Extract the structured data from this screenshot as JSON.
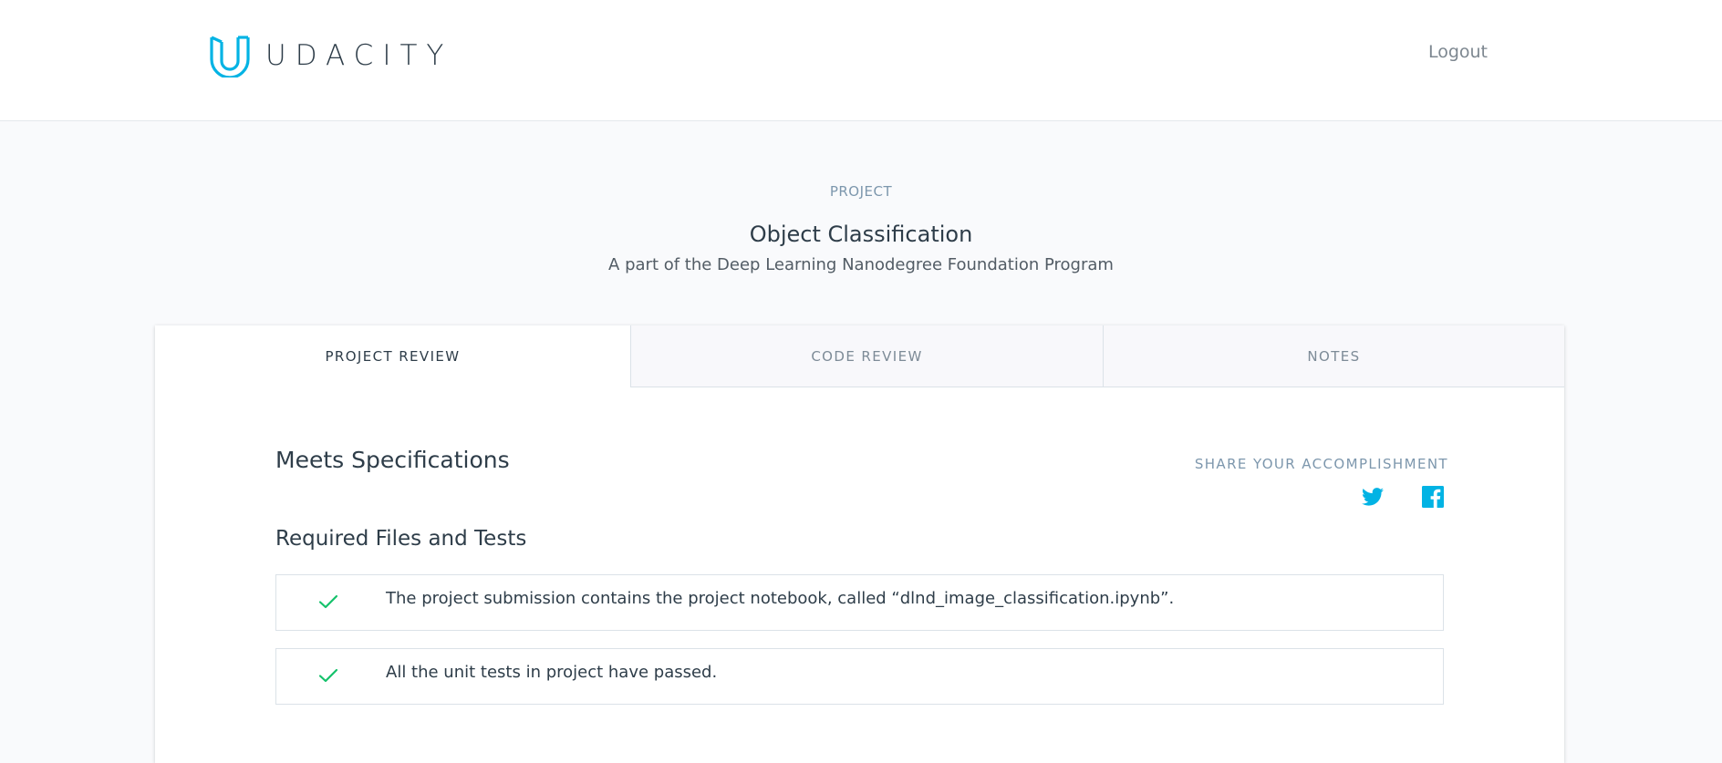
{
  "header": {
    "brand": "UDACITY",
    "logo_icon": "udacity-u-logo",
    "logout_label": "Logout"
  },
  "hero": {
    "eyebrow": "PROJECT",
    "title": "Object Classification",
    "subtitle": "A part of the Deep Learning Nanodegree Foundation Program"
  },
  "tabs": [
    {
      "label": "PROJECT REVIEW",
      "active": true
    },
    {
      "label": "CODE REVIEW",
      "active": false
    },
    {
      "label": "NOTES",
      "active": false
    }
  ],
  "review": {
    "status": "Meets Specifications",
    "share_label": "SHARE YOUR ACCOMPLISHMENT",
    "share_icons": [
      "twitter-icon",
      "facebook-icon"
    ],
    "section_title": "Required Files and Tests",
    "items": [
      {
        "icon": "check-icon",
        "text": "The project submission contains the project notebook, called “dlnd_image_classification.ipynb”."
      },
      {
        "icon": "check-icon",
        "text": "All the unit tests in project have passed."
      }
    ]
  },
  "colors": {
    "brand": "#02b3e4",
    "success": "#15c26b",
    "text": "#2e3d49",
    "muted": "#7d97ad"
  }
}
